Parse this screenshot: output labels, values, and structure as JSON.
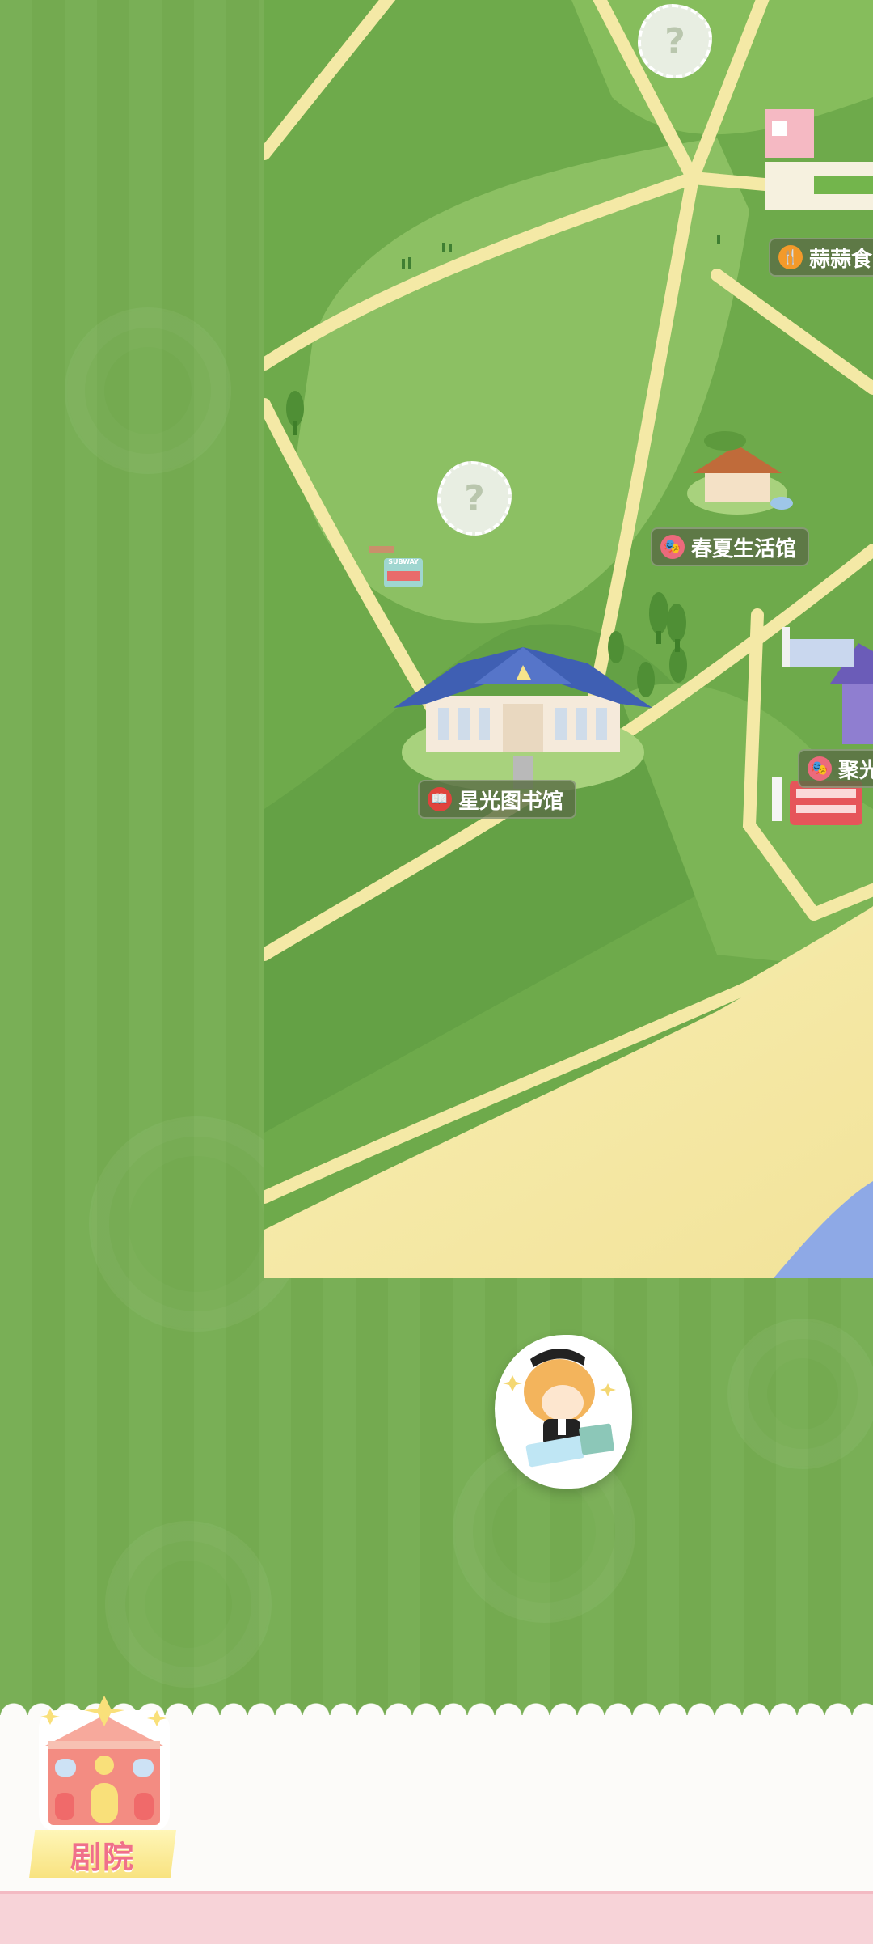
{
  "map": {
    "locations": [
      {
        "key": "library",
        "name": "星光图书馆",
        "icon": "book-icon",
        "icon_glyph": "📖",
        "icon_color": "#e0433d"
      },
      {
        "key": "spring_summer",
        "name": "春夏生活馆",
        "icon": "theater-mask-icon",
        "icon_glyph": "🎭",
        "icon_color": "#ec6a7c"
      },
      {
        "key": "spotlight",
        "name": "聚光",
        "icon": "theater-mask-icon",
        "icon_glyph": "🎭",
        "icon_color": "#ec6a7c"
      },
      {
        "key": "restaurant",
        "name": "蒜蒜食",
        "icon": "fork-knife-icon",
        "icon_glyph": "🍴",
        "icon_color": "#f39a2a"
      }
    ],
    "unknown_marker": "?",
    "bakery_sign": "SUBWAY"
  },
  "bottom_nav": {
    "theater_label": "剧院"
  },
  "colors": {
    "grass": "#76ad52",
    "path": "#f4e9a6",
    "beach": "#f6e9a8",
    "water": "#8ea9e6",
    "label_bg": "#5a6e46",
    "theater_text": "#f0708a"
  }
}
